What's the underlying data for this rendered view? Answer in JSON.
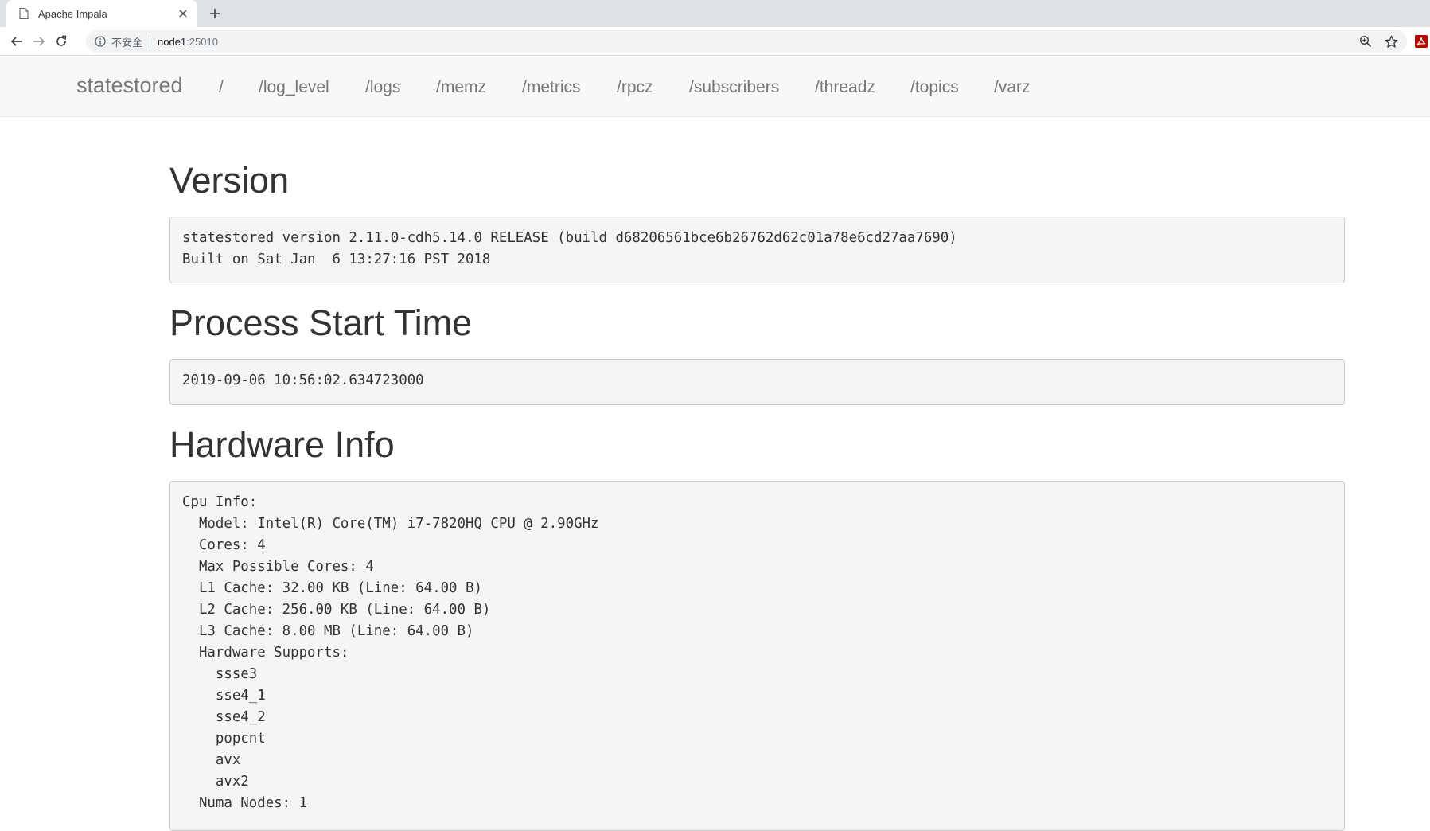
{
  "browser": {
    "tab_title": "Apache Impala",
    "security_label": "不安全",
    "url_host": "node1",
    "url_port": ":25010"
  },
  "navbar": {
    "brand": "statestored",
    "links": [
      "/",
      "/log_level",
      "/logs",
      "/memz",
      "/metrics",
      "/rpcz",
      "/subscribers",
      "/threadz",
      "/topics",
      "/varz"
    ]
  },
  "sections": {
    "version": {
      "heading": "Version",
      "text": "statestored version 2.11.0-cdh5.14.0 RELEASE (build d68206561bce6b26762d62c01a78e6cd27aa7690)\nBuilt on Sat Jan  6 13:27:16 PST 2018"
    },
    "start_time": {
      "heading": "Process Start Time",
      "text": "2019-09-06 10:56:02.634723000"
    },
    "hardware": {
      "heading": "Hardware Info",
      "text": "Cpu Info:\n  Model: Intel(R) Core(TM) i7-7820HQ CPU @ 2.90GHz\n  Cores: 4\n  Max Possible Cores: 4\n  L1 Cache: 32.00 KB (Line: 64.00 B)\n  L2 Cache: 256.00 KB (Line: 64.00 B)\n  L3 Cache: 8.00 MB (Line: 64.00 B)\n  Hardware Supports:\n    ssse3\n    sse4_1\n    sse4_2\n    popcnt\n    avx\n    avx2\n  Numa Nodes: 1"
    }
  },
  "colors": {
    "navbar_bg": "#f8f8f8",
    "nav_text": "#777777",
    "pre_bg": "#f5f5f5",
    "heading": "#333333"
  }
}
